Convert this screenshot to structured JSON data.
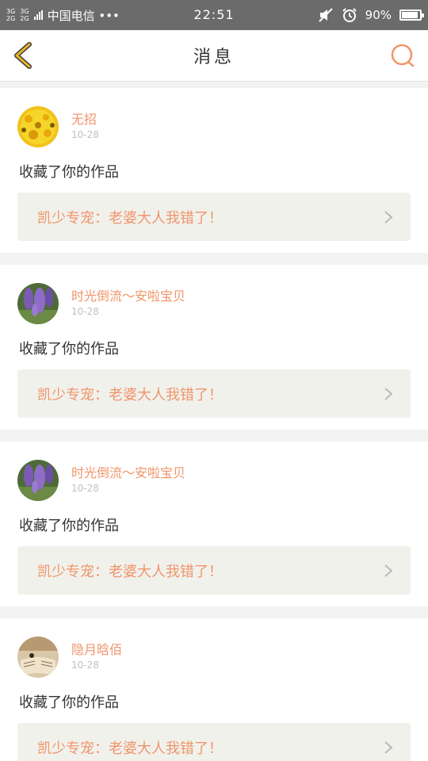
{
  "status_bar": {
    "network_top": "3G",
    "network_bottom": "2G",
    "network_top_2": "3G",
    "network_bottom_2": "2G",
    "carrier": "中国电信 •••",
    "time": "22:51",
    "battery": "90%"
  },
  "nav": {
    "title": "消息"
  },
  "messages": [
    {
      "username": "无招",
      "date": "10-28",
      "action": "收藏了你的作品",
      "work_title": "凯少专宠：老婆大人我错了！",
      "avatar": "sunflower"
    },
    {
      "username": "时光倒流～安啦宝贝",
      "date": "10-28",
      "action": "收藏了你的作品",
      "work_title": "凯少专宠：老婆大人我错了！",
      "avatar": "lavender"
    },
    {
      "username": "时光倒流～安啦宝贝",
      "date": "10-28",
      "action": "收藏了你的作品",
      "work_title": "凯少专宠：老婆大人我错了！",
      "avatar": "lavender"
    },
    {
      "username": "隐月晗佰",
      "date": "10-28",
      "action": "收藏了你的作品",
      "work_title": "凯少专宠：老婆大人我错了！",
      "avatar": "book"
    }
  ],
  "colors": {
    "accent": "#f0956a",
    "back_arrow": "#e8b22a",
    "card_bg": "#ffffff",
    "work_bg": "#f1f1ec"
  }
}
